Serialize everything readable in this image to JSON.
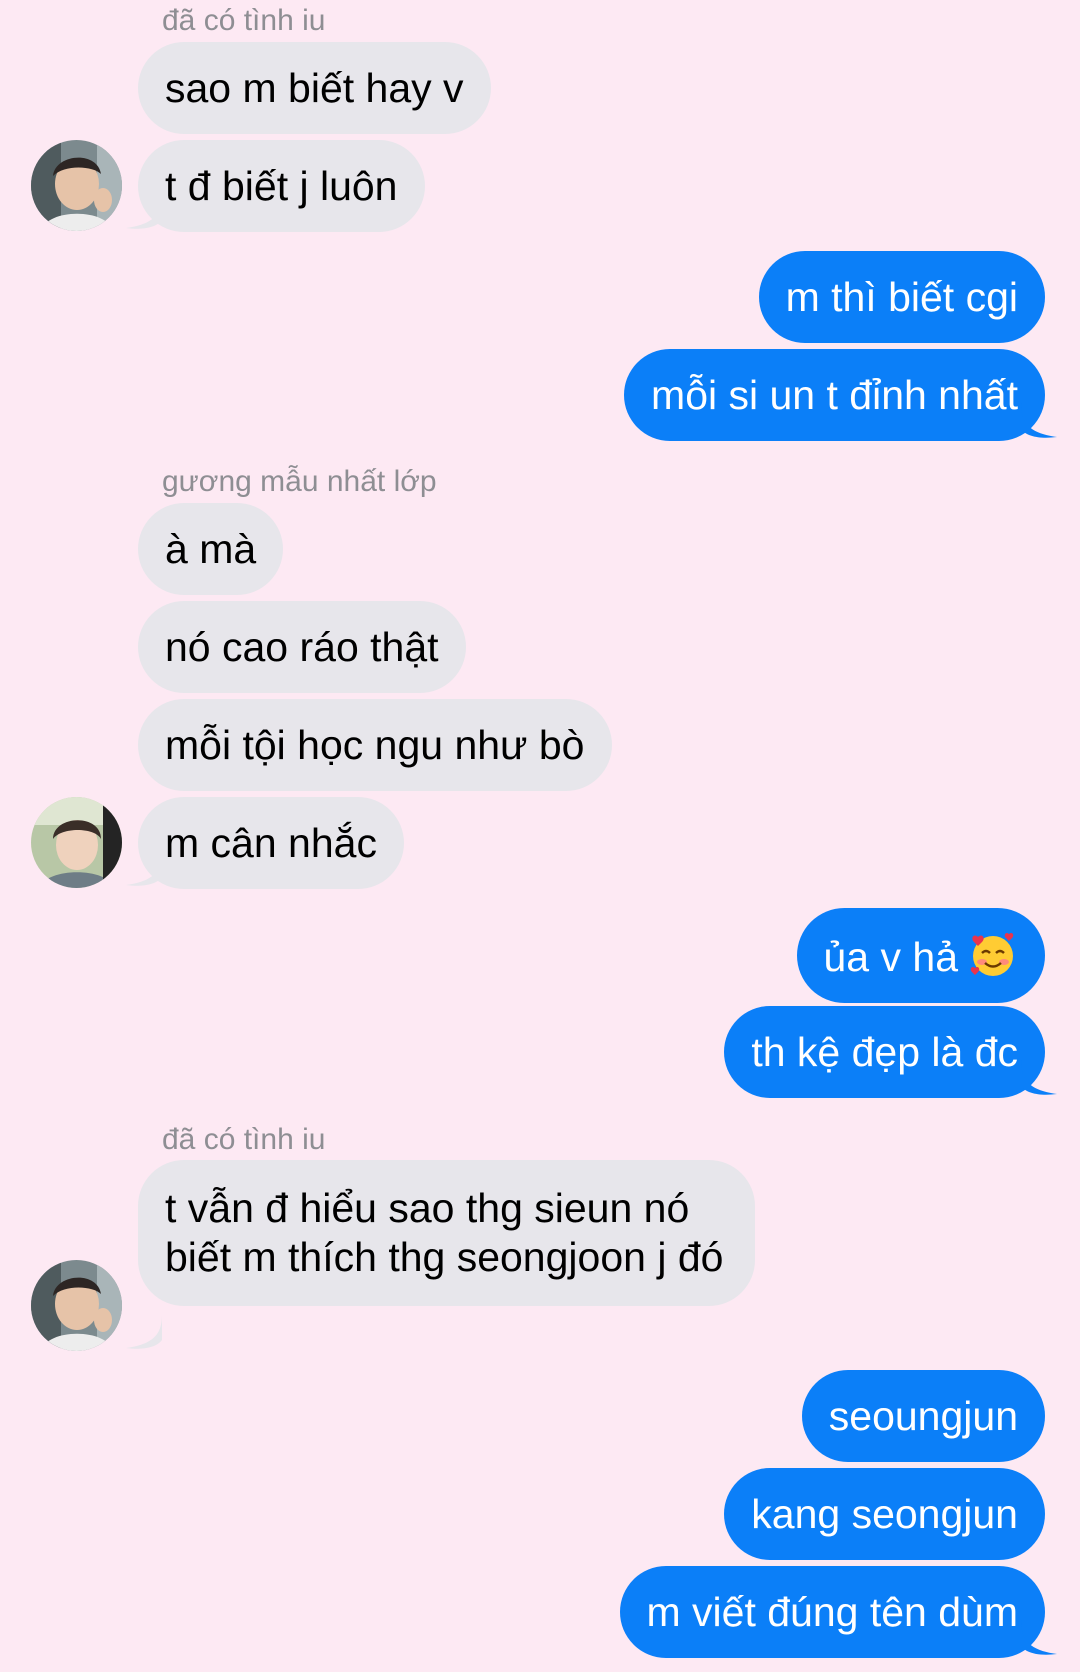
{
  "thread": {
    "sender_1": "đã có tình iu",
    "sender_2": "gương mẫu nhất lớp",
    "sender_3": "đã có tình iu",
    "messages": [
      "sao m biết hay v",
      "t đ biết j luôn",
      "m thì biết cgi",
      "mỗi si un t đỉnh nhất",
      "à mà",
      "nó cao ráo thật",
      "mỗi tội học ngu như bò",
      "m cân nhắc",
      "ủa v hả",
      "th kệ đẹp là đc",
      "t vẫn đ hiểu sao thg sieun nó biết m thích thg seongjoon j đó",
      "seoungjun",
      "kang seongjun",
      "m viết đúng tên dùm"
    ],
    "emoji_icon": "smiling-face-with-hearts-icon"
  },
  "colors": {
    "background": "#fde9f3",
    "incoming_bubble": "#e7e6eb",
    "outgoing_bubble": "#0b7ff8",
    "sender_label": "#8e8e93"
  }
}
